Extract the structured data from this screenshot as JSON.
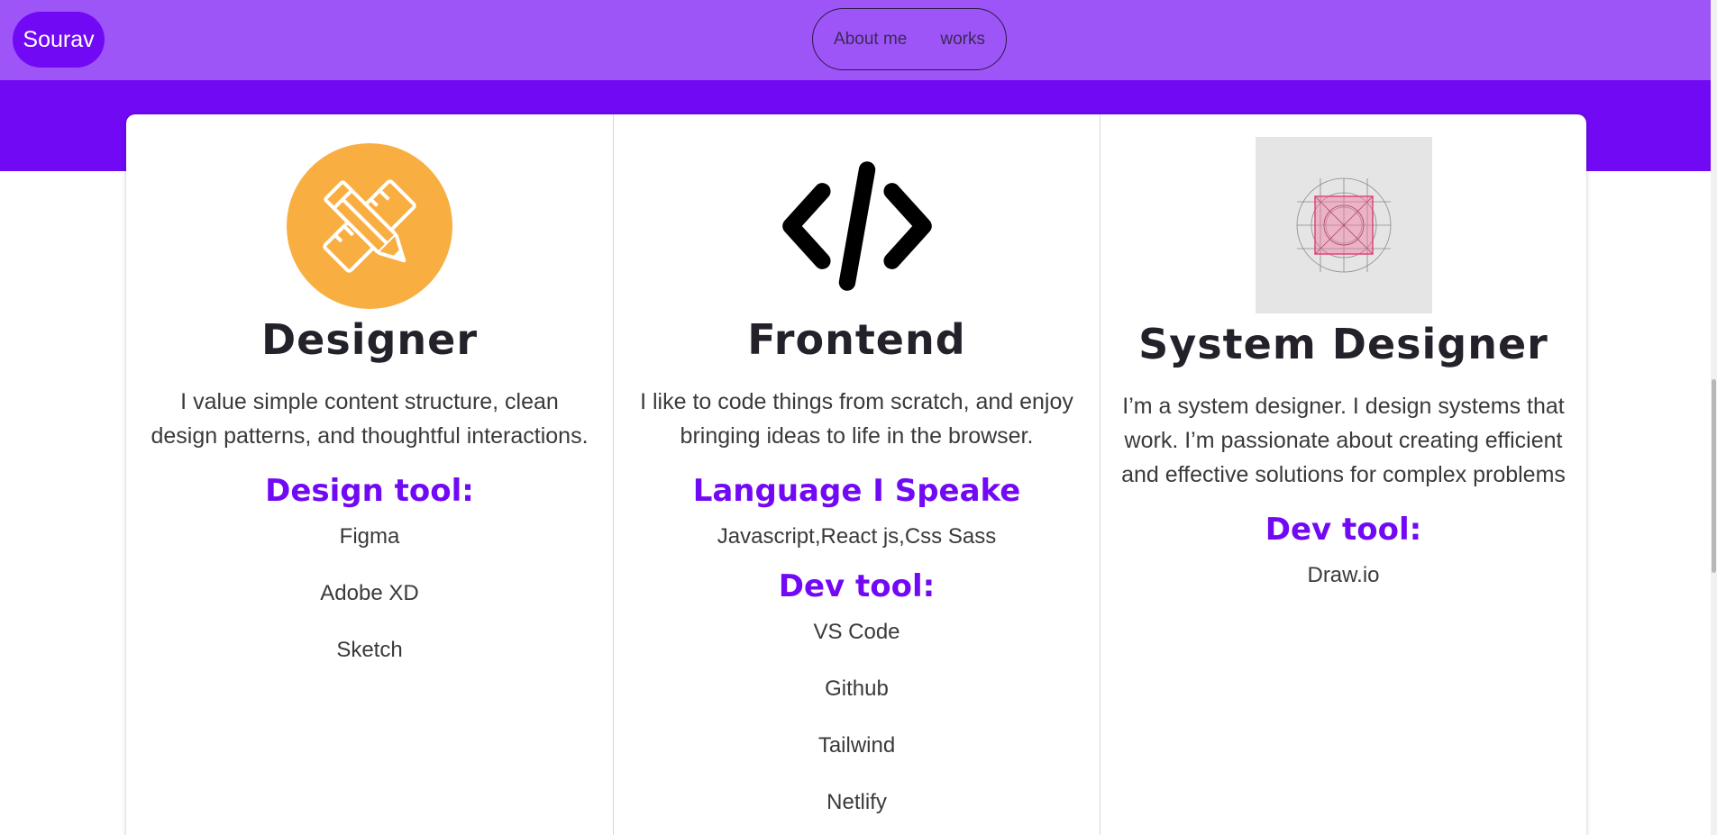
{
  "nav": {
    "logo_text": "Sourav",
    "links": [
      "About me",
      "works"
    ]
  },
  "colors": {
    "nav_bg": "#9d55f8",
    "brand_purple": "#7209f5",
    "designer_icon_orange": "#f9ae41"
  },
  "columns": [
    {
      "icon": "pencil-ruler-icon",
      "title": "Designer",
      "description": "I value simple content structure, clean design patterns, and thoughtful interactions.",
      "section_heading": "Design tool:",
      "tools": [
        "Figma",
        "Adobe XD",
        "Sketch"
      ]
    },
    {
      "icon": "code-brackets-icon",
      "title": "Frontend",
      "description": "I like to code things from scratch, and enjoy bringing ideas to life in the browser.",
      "language_heading": "Language I Speake",
      "languages": "Javascript,React js,Css Sass",
      "section_heading": "Dev tool:",
      "tools": [
        "VS Code",
        "Github",
        "Tailwind",
        "Netlify"
      ]
    },
    {
      "icon": "design-grid-icon",
      "title": "System Designer",
      "description": "I’m a system designer. I design systems that work. I’m passionate about creating efficient and effective solutions for complex problems",
      "section_heading": "Dev tool:",
      "tools": [
        "Draw.io"
      ]
    }
  ]
}
